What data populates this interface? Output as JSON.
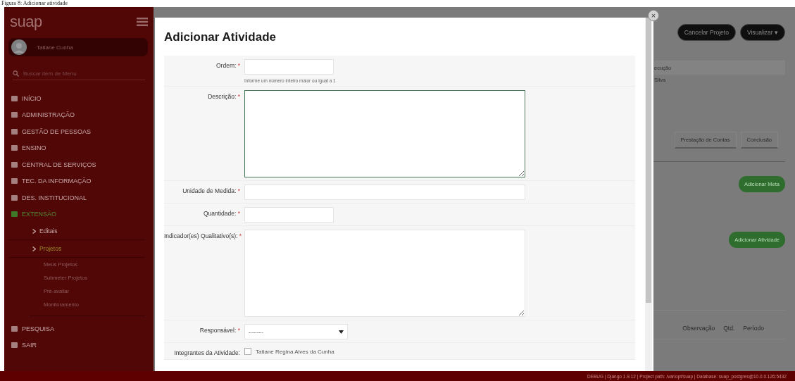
{
  "caption": "Figura 8: Adicionar atividade",
  "sidebar": {
    "logo": "suap",
    "user_name": "Tatiane Cunha",
    "search_placeholder": "Buscar item de Menu",
    "items": [
      {
        "label": "INÍCIO",
        "selected": false
      },
      {
        "label": "ADMINISTRAÇÃO",
        "selected": false
      },
      {
        "label": "GESTÃO DE PESSOAS",
        "selected": false
      },
      {
        "label": "ENSINO",
        "selected": false
      },
      {
        "label": "CENTRAL DE SERVIÇOS",
        "selected": false
      },
      {
        "label": "TEC. DA INFORMAÇÃO",
        "selected": false
      },
      {
        "label": "DES. INSTITUCIONAL",
        "selected": false
      },
      {
        "label": "EXTENSÃO",
        "selected": true,
        "children": [
          {
            "label": "Editais",
            "selected": false
          },
          {
            "label": "Projetos",
            "selected": true,
            "children": [
              {
                "label": "Meus Projetos",
                "selected": false
              },
              {
                "label": "Submeter Projetos",
                "selected": false
              },
              {
                "label": "Pré-avaliar",
                "selected": false
              },
              {
                "label": "Monitoramento",
                "selected": false
              }
            ]
          }
        ]
      },
      {
        "label": "PESQUISA",
        "selected": false
      },
      {
        "label": "SAIR",
        "selected": false
      }
    ]
  },
  "page": {
    "buttons": [
      "Cancelar Projeto",
      "Visualizar ▾"
    ],
    "info": [
      "ecução",
      "Silva"
    ],
    "tabs": [
      {
        "label": "Prestação de Contas",
        "selected": false
      },
      {
        "label": "Conclusão",
        "selected": false
      }
    ],
    "actions": [
      "Adicionar Meta",
      "Adicionar Atividade"
    ],
    "table_columns": [
      "Observação",
      "Qtd.",
      "Período"
    ]
  },
  "modal": {
    "title": "Adicionar Atividade",
    "close": "×",
    "fields": [
      {
        "kind": "short_input",
        "label": "Ordem:",
        "required_mark": "*",
        "hint": "Informe um número inteiro maior ou igual a 1"
      },
      {
        "kind": "textarea",
        "label": "Descrição:",
        "required_mark": "*",
        "focused": true
      },
      {
        "kind": "long_input",
        "label": "Unidade de Medida:",
        "required_mark": "*"
      },
      {
        "kind": "short_input",
        "label": "Quantidade:",
        "required_mark": "*"
      },
      {
        "kind": "textarea",
        "label": "Indicador(es) Qualitativo(s):",
        "required_mark": "*",
        "focused": false
      },
      {
        "kind": "select",
        "label": "Responsável:",
        "required_mark": "*",
        "value": "---------"
      },
      {
        "kind": "checkboxes",
        "label": "Integrantes da Atividade:",
        "options": [
          {
            "label": "Tatiane Regina Alves da Cunha",
            "checked": false
          }
        ]
      }
    ]
  },
  "debug_bar": "DEBUG | Django 1.9.12 | Project path: /var/opt/suap | Database: suap_postgres@10.0.0.126:5432"
}
